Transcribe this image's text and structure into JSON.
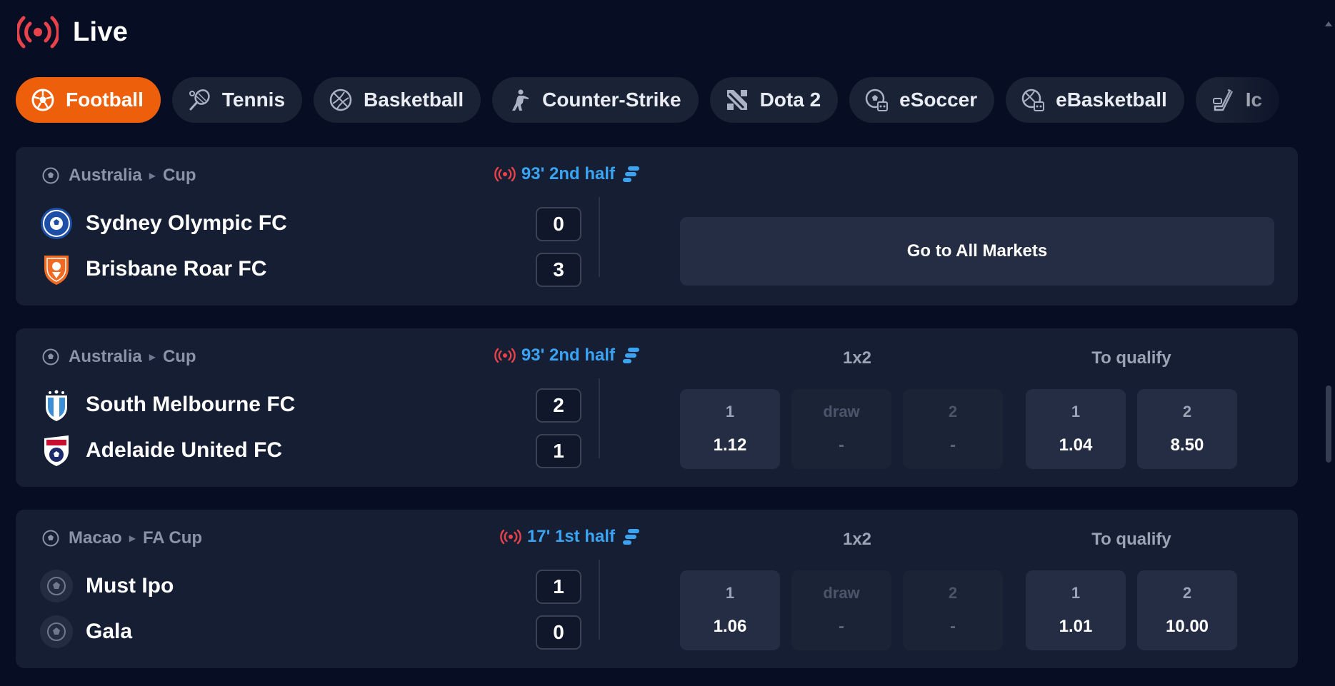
{
  "page": {
    "title": "Live"
  },
  "colors": {
    "accent": "#ee5f0b",
    "live": "#e8434b",
    "status": "#3aa3f2",
    "background": "#070e24",
    "card": "#161e33"
  },
  "tabs": [
    {
      "label": "Football",
      "icon": "football-icon",
      "active": true
    },
    {
      "label": "Tennis",
      "icon": "tennis-icon",
      "active": false
    },
    {
      "label": "Basketball",
      "icon": "basketball-icon",
      "active": false
    },
    {
      "label": "Counter-Strike",
      "icon": "counter-strike-icon",
      "active": false
    },
    {
      "label": "Dota 2",
      "icon": "dota2-icon",
      "active": false
    },
    {
      "label": "eSoccer",
      "icon": "esoccer-icon",
      "active": false
    },
    {
      "label": "eBasketball",
      "icon": "ebasketball-icon",
      "active": false
    },
    {
      "label": "Ic",
      "icon": "ice-hockey-icon",
      "active": false
    }
  ],
  "matches": [
    {
      "country": "Australia",
      "tournament": "Cup",
      "status": "93' 2nd half",
      "home": {
        "name": "Sydney Olympic FC",
        "score": "0",
        "logo": "sydney-olympic-logo"
      },
      "away": {
        "name": "Brisbane Roar FC",
        "score": "3",
        "logo": "brisbane-roar-logo"
      },
      "action_label": "Go to All Markets"
    },
    {
      "country": "Australia",
      "tournament": "Cup",
      "status": "93' 2nd half",
      "home": {
        "name": "South Melbourne FC",
        "score": "2",
        "logo": "south-melbourne-logo"
      },
      "away": {
        "name": "Adelaide United FC",
        "score": "1",
        "logo": "adelaide-united-logo"
      },
      "market1": {
        "title": "1x2",
        "odds": [
          {
            "label": "1",
            "value": "1.12"
          },
          {
            "label": "draw",
            "value": "-"
          },
          {
            "label": "2",
            "value": "-"
          }
        ]
      },
      "market2": {
        "title": "To qualify",
        "odds": [
          {
            "label": "1",
            "value": "1.04"
          },
          {
            "label": "2",
            "value": "8.50"
          }
        ]
      }
    },
    {
      "country": "Macao",
      "tournament": "FA Cup",
      "status": "17' 1st half",
      "home": {
        "name": "Must Ipo",
        "score": "1",
        "logo": "default-team-logo"
      },
      "away": {
        "name": "Gala",
        "score": "0",
        "logo": "default-team-logo"
      },
      "market1": {
        "title": "1x2",
        "odds": [
          {
            "label": "1",
            "value": "1.06"
          },
          {
            "label": "draw",
            "value": "-"
          },
          {
            "label": "2",
            "value": "-"
          }
        ]
      },
      "market2": {
        "title": "To qualify",
        "odds": [
          {
            "label": "1",
            "value": "1.01"
          },
          {
            "label": "2",
            "value": "10.00"
          }
        ]
      }
    }
  ]
}
